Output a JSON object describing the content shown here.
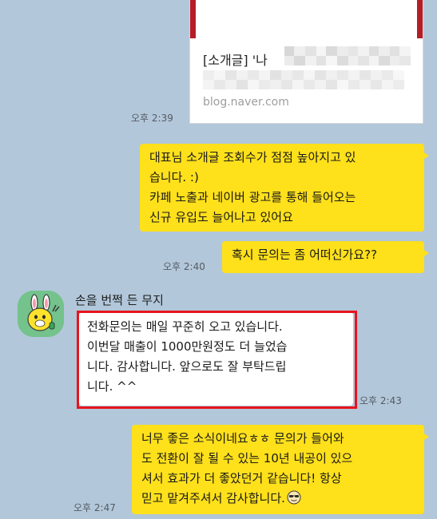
{
  "link_preview": {
    "title_prefix": "[소개글] '나",
    "domain": "blog.naver.com",
    "time": "오후 2:39",
    "accent_color": "#b51d26"
  },
  "messages": [
    {
      "side": "right",
      "time": "오후 2:39",
      "lines": [
        "대표님 소개글 조회수가 점점 높아지고 있",
        "습니다. :)",
        "카페 노출과 네이버 광고를 통해 들어오는",
        "신규 유입도 늘어나고 있어요"
      ]
    },
    {
      "side": "right",
      "time": "오후 2:40",
      "lines": [
        "혹시 문의는 좀 어떠신가요??"
      ]
    },
    {
      "side": "left",
      "sender": "손을 번쩍 든 무지",
      "avatar": "muzi-avatar",
      "time": "오후 2:43",
      "highlighted": true,
      "lines": [
        "전화문의는 매일 꾸준히 오고 있습니다.",
        "이번달 매출이 1000만원정도 더 늘었습",
        "니다. 감사합니다. 앞으로도 잘 부탁드립",
        "니다. ^^"
      ]
    },
    {
      "side": "right",
      "time": "오후 2:47",
      "lines": [
        "너무 좋은 소식이네요ㅎㅎ 문의가 들어와",
        "도 전환이 잘 될 수 있는 10년 내공이 있으",
        "셔서 효과가 더 좋았던거 같습니다! 항상",
        "믿고 맡겨주셔서 감사합니다."
      ],
      "emoji_icon": "smiling-face-with-sunglasses-icon"
    }
  ],
  "colors": {
    "background": "#b2c7da",
    "my_bubble": "#fee01b",
    "their_bubble": "#ffffff",
    "highlight_border": "#e8141c"
  }
}
